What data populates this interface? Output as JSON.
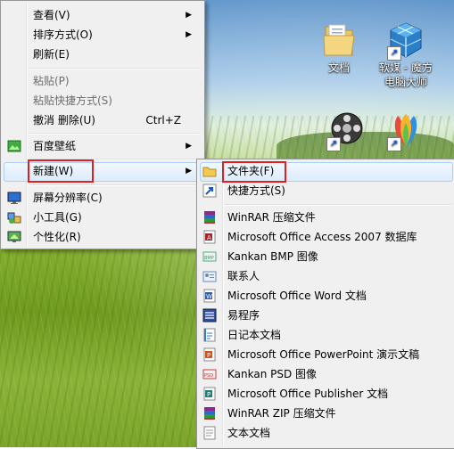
{
  "desktop": {
    "icons": [
      {
        "name": "文档"
      },
      {
        "name_line1": "软媒 - 魔方",
        "name_line2": "电脑大师"
      }
    ]
  },
  "context_menu": {
    "items": [
      {
        "label": "查看(V)",
        "submenu": true
      },
      {
        "label": "排序方式(O)",
        "submenu": true
      },
      {
        "label": "刷新(E)"
      },
      {
        "label": "粘贴(P)",
        "disabled": true
      },
      {
        "label": "粘贴快捷方式(S)",
        "disabled": true
      },
      {
        "label": "撤消 删除(U)",
        "shortcut": "Ctrl+Z"
      },
      {
        "label": "百度壁纸",
        "submenu": true,
        "icon": "baidu-wallpaper-icon"
      },
      {
        "label": "新建(W)",
        "submenu": true,
        "highlighted": true
      },
      {
        "label": "屏幕分辨率(C)",
        "icon": "screen-resolution-icon"
      },
      {
        "label": "小工具(G)",
        "icon": "gadgets-icon"
      },
      {
        "label": "个性化(R)",
        "icon": "personalize-icon"
      }
    ]
  },
  "new_submenu": {
    "items": [
      {
        "label": "文件夹(F)",
        "icon": "folder-icon",
        "highlighted": true
      },
      {
        "label": "快捷方式(S)",
        "icon": "shortcut-icon"
      },
      {
        "label": "WinRAR 压缩文件",
        "icon": "winrar-icon"
      },
      {
        "label": "Microsoft Office Access 2007 数据库",
        "icon": "access-icon"
      },
      {
        "label": "Kankan BMP 图像",
        "icon": "bmp-icon"
      },
      {
        "label": "联系人",
        "icon": "contact-icon"
      },
      {
        "label": "Microsoft Office Word 文档",
        "icon": "word-icon"
      },
      {
        "label": "易程序",
        "icon": "e-program-icon"
      },
      {
        "label": "日记本文档",
        "icon": "journal-icon"
      },
      {
        "label": "Microsoft Office PowerPoint 演示文稿",
        "icon": "powerpoint-icon"
      },
      {
        "label": "Kankan PSD 图像",
        "icon": "psd-icon"
      },
      {
        "label": "Microsoft Office Publisher 文档",
        "icon": "publisher-icon"
      },
      {
        "label": "WinRAR ZIP 压缩文件",
        "icon": "winrar-zip-icon"
      },
      {
        "label": "文本文档",
        "icon": "text-doc-icon"
      }
    ]
  }
}
